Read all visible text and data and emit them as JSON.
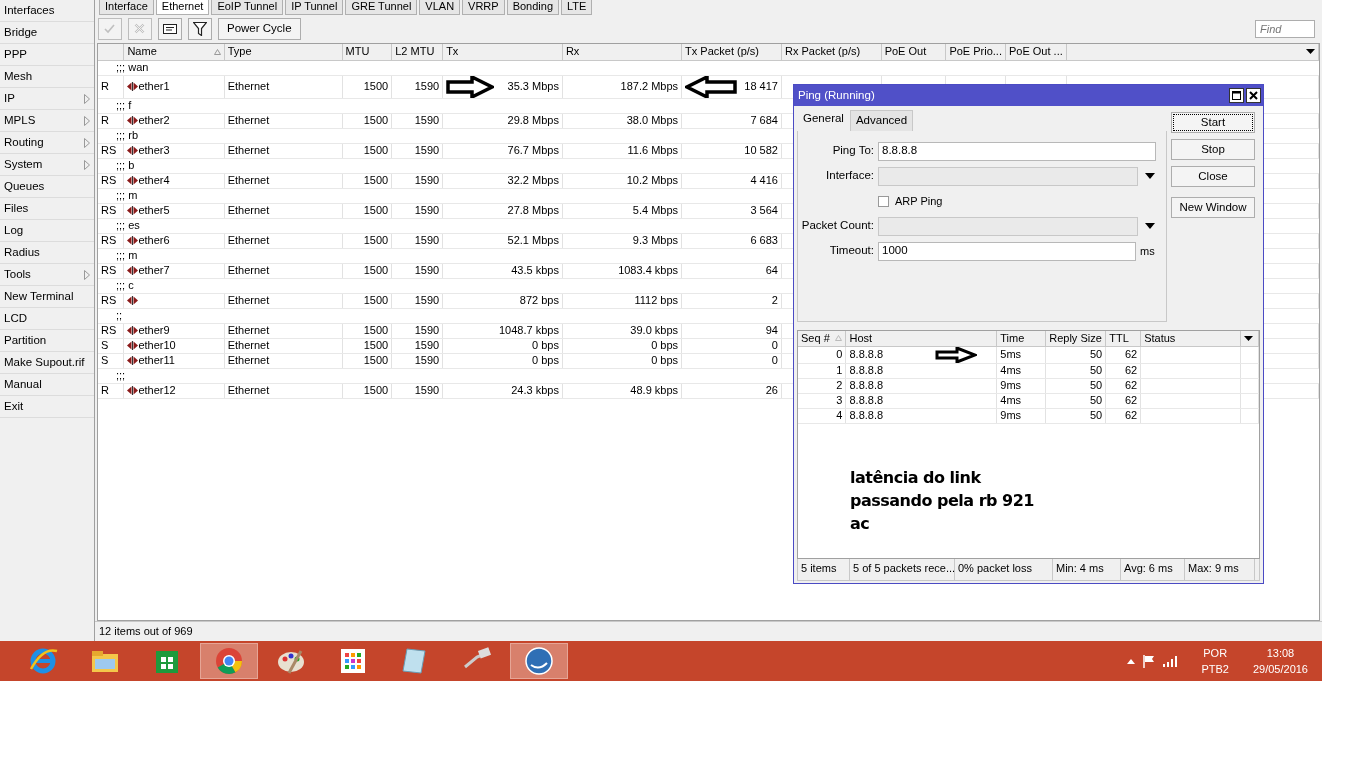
{
  "sidebar": {
    "items": [
      {
        "label": "Interfaces",
        "submenu": false
      },
      {
        "label": "Bridge",
        "submenu": false
      },
      {
        "label": "PPP",
        "submenu": false
      },
      {
        "label": "Mesh",
        "submenu": false
      },
      {
        "label": "IP",
        "submenu": true
      },
      {
        "label": "MPLS",
        "submenu": true
      },
      {
        "label": "Routing",
        "submenu": true
      },
      {
        "label": "System",
        "submenu": true
      },
      {
        "label": "Queues",
        "submenu": false
      },
      {
        "label": "Files",
        "submenu": false
      },
      {
        "label": "Log",
        "submenu": false
      },
      {
        "label": "Radius",
        "submenu": false
      },
      {
        "label": "Tools",
        "submenu": true
      },
      {
        "label": "New Terminal",
        "submenu": false
      },
      {
        "label": "LCD",
        "submenu": false
      },
      {
        "label": "Partition",
        "submenu": false
      },
      {
        "label": "Make Supout.rif",
        "submenu": false
      },
      {
        "label": "Manual",
        "submenu": false
      },
      {
        "label": "Exit",
        "submenu": false
      }
    ]
  },
  "tabs": [
    {
      "label": "Interface",
      "selected": false
    },
    {
      "label": "Ethernet",
      "selected": true
    },
    {
      "label": "EoIP Tunnel",
      "selected": false
    },
    {
      "label": "IP Tunnel",
      "selected": false
    },
    {
      "label": "GRE Tunnel",
      "selected": false
    },
    {
      "label": "VLAN",
      "selected": false
    },
    {
      "label": "VRRP",
      "selected": false
    },
    {
      "label": "Bonding",
      "selected": false
    },
    {
      "label": "LTE",
      "selected": false
    }
  ],
  "toolbar": {
    "buttons": [
      {
        "kind": "check",
        "disabled": true
      },
      {
        "kind": "remove",
        "disabled": true
      },
      {
        "kind": "comment",
        "disabled": false
      },
      {
        "kind": "filter",
        "disabled": false
      },
      {
        "kind": "text",
        "label": "Power Cycle",
        "disabled": false
      }
    ],
    "search": {
      "placeholder": "Find"
    }
  },
  "table": {
    "columns": [
      {
        "label": "Name",
        "sorted": true
      },
      {
        "label": "Type"
      },
      {
        "label": "MTU"
      },
      {
        "label": "L2 MTU"
      },
      {
        "label": "Tx"
      },
      {
        "label": "Rx"
      },
      {
        "label": "Tx Packet (p/s)"
      },
      {
        "label": "Rx Packet (p/s)"
      },
      {
        "label": "PoE Out"
      },
      {
        "label": "PoE Prio..."
      },
      {
        "label": "PoE Out ..."
      }
    ],
    "rows": [
      {
        "kind": "comment",
        "text": ";;; wan"
      },
      {
        "kind": "interface",
        "flags": "R",
        "name": "ether1",
        "type": "Ethernet",
        "mtu": "1500",
        "l2_mtu": "1590",
        "tx": "35.3 Mbps",
        "rx": "187.2 Mbps",
        "tx_packet": "18 417",
        "marked": true
      },
      {
        "kind": "comment",
        "text": ";;; f"
      },
      {
        "kind": "interface",
        "flags": "R",
        "name": "ether2",
        "type": "Ethernet",
        "mtu": "1500",
        "l2_mtu": "1590",
        "tx": "29.8 Mbps",
        "rx": "38.0 Mbps",
        "tx_packet": "7 684",
        "marked": false
      },
      {
        "kind": "comment",
        "text": ";;; rb"
      },
      {
        "kind": "interface",
        "flags": "RS",
        "name": "ether3",
        "type": "Ethernet",
        "mtu": "1500",
        "l2_mtu": "1590",
        "tx": "76.7 Mbps",
        "rx": "11.6 Mbps",
        "tx_packet": "10 582",
        "marked": false
      },
      {
        "kind": "comment",
        "text": ";;; b"
      },
      {
        "kind": "interface",
        "flags": "RS",
        "name": "ether4",
        "type": "Ethernet",
        "mtu": "1500",
        "l2_mtu": "1590",
        "tx": "32.2 Mbps",
        "rx": "10.2 Mbps",
        "tx_packet": "4 416",
        "marked": false
      },
      {
        "kind": "comment",
        "text": ";;; m"
      },
      {
        "kind": "interface",
        "flags": "RS",
        "name": "ether5",
        "type": "Ethernet",
        "mtu": "1500",
        "l2_mtu": "1590",
        "tx": "27.8 Mbps",
        "rx": "5.4 Mbps",
        "tx_packet": "3 564",
        "marked": false
      },
      {
        "kind": "comment",
        "text": ";;; es"
      },
      {
        "kind": "interface",
        "flags": "RS",
        "name": "ether6",
        "type": "Ethernet",
        "mtu": "1500",
        "l2_mtu": "1590",
        "tx": "52.1 Mbps",
        "rx": "9.3 Mbps",
        "tx_packet": "6 683",
        "marked": false
      },
      {
        "kind": "comment",
        "text": ";;; m"
      },
      {
        "kind": "interface",
        "flags": "RS",
        "name": "ether7",
        "type": "Ethernet",
        "mtu": "1500",
        "l2_mtu": "1590",
        "tx": "43.5 kbps",
        "rx": "1083.4 kbps",
        "tx_packet": "64",
        "marked": false
      },
      {
        "kind": "comment",
        "text": ";;; c"
      },
      {
        "kind": "interface",
        "flags": "RS",
        "type": "Ethernet",
        "mtu": "1500",
        "l2_mtu": "1590",
        "tx": "872 bps",
        "rx": "1112 bps",
        "tx_packet": "2",
        "marked": false
      },
      {
        "kind": "comment",
        "text": ";;"
      },
      {
        "kind": "interface",
        "flags": "RS",
        "name": "ether9",
        "type": "Ethernet",
        "mtu": "1500",
        "l2_mtu": "1590",
        "tx": "1048.7 kbps",
        "rx": "39.0 kbps",
        "tx_packet": "94",
        "marked": false
      },
      {
        "kind": "interface",
        "flags": "S",
        "name": "ether10",
        "type": "Ethernet",
        "mtu": "1500",
        "l2_mtu": "1590",
        "tx": "0 bps",
        "rx": "0 bps",
        "tx_packet": "0",
        "marked": false
      },
      {
        "kind": "interface",
        "flags": "S",
        "name": "ether11",
        "type": "Ethernet",
        "mtu": "1500",
        "l2_mtu": "1590",
        "tx": "0 bps",
        "rx": "0 bps",
        "tx_packet": "0",
        "marked": false
      },
      {
        "kind": "comment",
        "text": ";;;"
      },
      {
        "kind": "interface",
        "flags": "R",
        "name": "ether12",
        "type": "Ethernet",
        "mtu": "1500",
        "l2_mtu": "1590",
        "tx": "24.3 kbps",
        "rx": "48.9 kbps",
        "tx_packet": "26",
        "marked": false
      }
    ]
  },
  "status_bar": "12 items out of 969",
  "ping_window": {
    "title": "Ping (Running)",
    "tabs": [
      {
        "label": "General",
        "selected": true
      },
      {
        "label": "Advanced",
        "selected": false
      }
    ],
    "fields": [
      {
        "kind": "text",
        "label": "Ping To:",
        "value": "8.8.8.8"
      },
      {
        "kind": "dropdown",
        "label": "Interface:"
      },
      {
        "kind": "checkbox",
        "label": "ARP Ping",
        "checked": false
      },
      {
        "kind": "dropdown",
        "label": "Packet Count:"
      },
      {
        "kind": "text",
        "label": "Timeout:",
        "value": "1000",
        "unit": "ms"
      }
    ],
    "buttons": [
      {
        "label": "Start",
        "focused": true
      },
      {
        "label": "Stop",
        "focused": false
      },
      {
        "label": "Close",
        "focused": false
      },
      {
        "label": "New Window",
        "focused": false
      }
    ],
    "columns": [
      {
        "label": "Seq #",
        "sorted": true
      },
      {
        "label": "Host"
      },
      {
        "label": "Time"
      },
      {
        "label": "Reply Size"
      },
      {
        "label": "TTL"
      },
      {
        "label": "Status"
      }
    ],
    "rows": [
      {
        "seq": "0",
        "host": "8.8.8.8",
        "time": "5ms",
        "reply_size": "50",
        "ttl": "62",
        "marked": true
      },
      {
        "seq": "1",
        "host": "8.8.8.8",
        "time": "4ms",
        "reply_size": "50",
        "ttl": "62",
        "marked": false
      },
      {
        "seq": "2",
        "host": "8.8.8.8",
        "time": "9ms",
        "reply_size": "50",
        "ttl": "62",
        "marked": false
      },
      {
        "seq": "3",
        "host": "8.8.8.8",
        "time": "4ms",
        "reply_size": "50",
        "ttl": "62",
        "marked": false
      },
      {
        "seq": "4",
        "host": "8.8.8.8",
        "time": "9ms",
        "reply_size": "50",
        "ttl": "62",
        "marked": false
      }
    ],
    "note": [
      "latência do link",
      "passando pela rb 921",
      "ac"
    ],
    "status": [
      "5 items",
      "5 of 5 packets rece...",
      "0% packet loss",
      "Min: 4 ms",
      "Avg: 6 ms",
      "Max: 9 ms"
    ]
  },
  "taskbar": {
    "apps": [
      {
        "kind": "ie",
        "active": false
      },
      {
        "kind": "explorer",
        "active": false
      },
      {
        "kind": "store",
        "active": false
      },
      {
        "kind": "chrome",
        "active": true
      },
      {
        "kind": "paint",
        "active": false
      },
      {
        "kind": "apps",
        "active": false
      },
      {
        "kind": "notepad",
        "active": false
      },
      {
        "kind": "network",
        "active": false
      },
      {
        "kind": "winbox",
        "active": true
      }
    ],
    "language": [
      "POR",
      "PTB2"
    ],
    "time": "13:08",
    "date": "29/05/2016"
  }
}
